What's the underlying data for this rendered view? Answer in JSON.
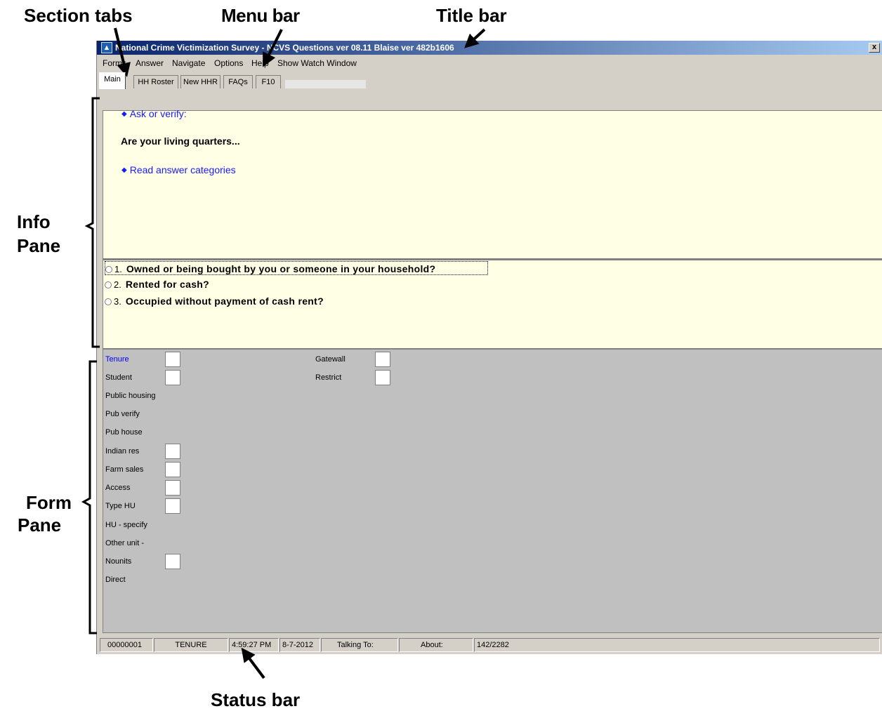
{
  "callouts": {
    "section_tabs": "Section tabs",
    "menu_bar": "Menu bar",
    "title_bar": "Title bar",
    "info_pane_1": "Info",
    "info_pane_2": "Pane",
    "form_pane_1": "Form",
    "form_pane_2": "Pane",
    "status_bar": "Status bar"
  },
  "window": {
    "title": "National Crime Victimization Survey - NCVS Questions ver 08.11 Blaise ver 482b1606",
    "close": "x"
  },
  "menu": {
    "forms": "Forms",
    "answer": "Answer",
    "navigate": "Navigate",
    "options": "Options",
    "help": "Help",
    "watch": "Show Watch Window"
  },
  "tabs": [
    "Main",
    "HH Roster",
    "New HHR",
    "FAQs",
    "F10"
  ],
  "info": {
    "instruction_1": "Ask or verify:",
    "question": "Are your living quarters...",
    "instruction_2": "Read answer categories"
  },
  "answers": [
    {
      "num": "1.",
      "text": "Owned or being bought by you or someone in your household?"
    },
    {
      "num": "2.",
      "text": "Rented for cash?"
    },
    {
      "num": "3.",
      "text": "Occupied without payment of cash rent?"
    }
  ],
  "form": {
    "left_fields": [
      "Tenure",
      "Student",
      "Public housing",
      "Pub verify",
      "Pub house",
      "Indian res",
      "Farm sales",
      "Access",
      "Type HU",
      "HU - specify",
      "Other unit -",
      "Nounits",
      "Direct"
    ],
    "right_fields": [
      "Gatewall",
      "Restrict"
    ]
  },
  "status": {
    "id": "00000001",
    "field": "TENURE",
    "time": "4:59:27 PM",
    "date": "8-7-2012",
    "talking": "Talking To:",
    "about": "About:",
    "count": "142/2282"
  }
}
